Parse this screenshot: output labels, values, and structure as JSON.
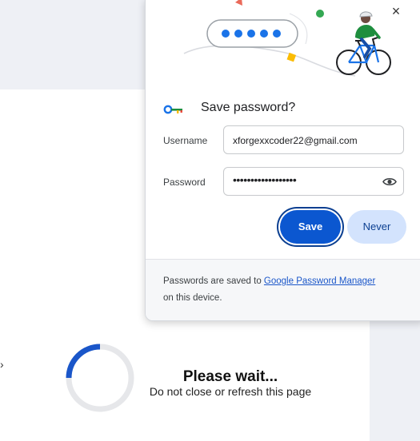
{
  "dialog": {
    "title": "Save password?",
    "username_label": "Username",
    "username_value": "xforgexxcoder22@gmail.com",
    "password_label": "Password",
    "password_masked": "••••••••••••••••••",
    "save_label": "Save",
    "never_label": "Never",
    "close_glyph": "×",
    "footer_prefix": "Passwords are saved to ",
    "footer_link": "Google Password Manager",
    "footer_suffix": "on this device.",
    "colors": {
      "primary": "#0b57d0",
      "secondary_button": "#d3e3fd",
      "link": "#1a56c9"
    }
  },
  "background": {
    "wait_title": "Please wait...",
    "wait_subtitle": "Do not close or refresh this page",
    "spinner_color": "#1a56c9"
  },
  "icons": {
    "key": "key-icon",
    "eye": "eye-icon",
    "close": "close-icon"
  }
}
